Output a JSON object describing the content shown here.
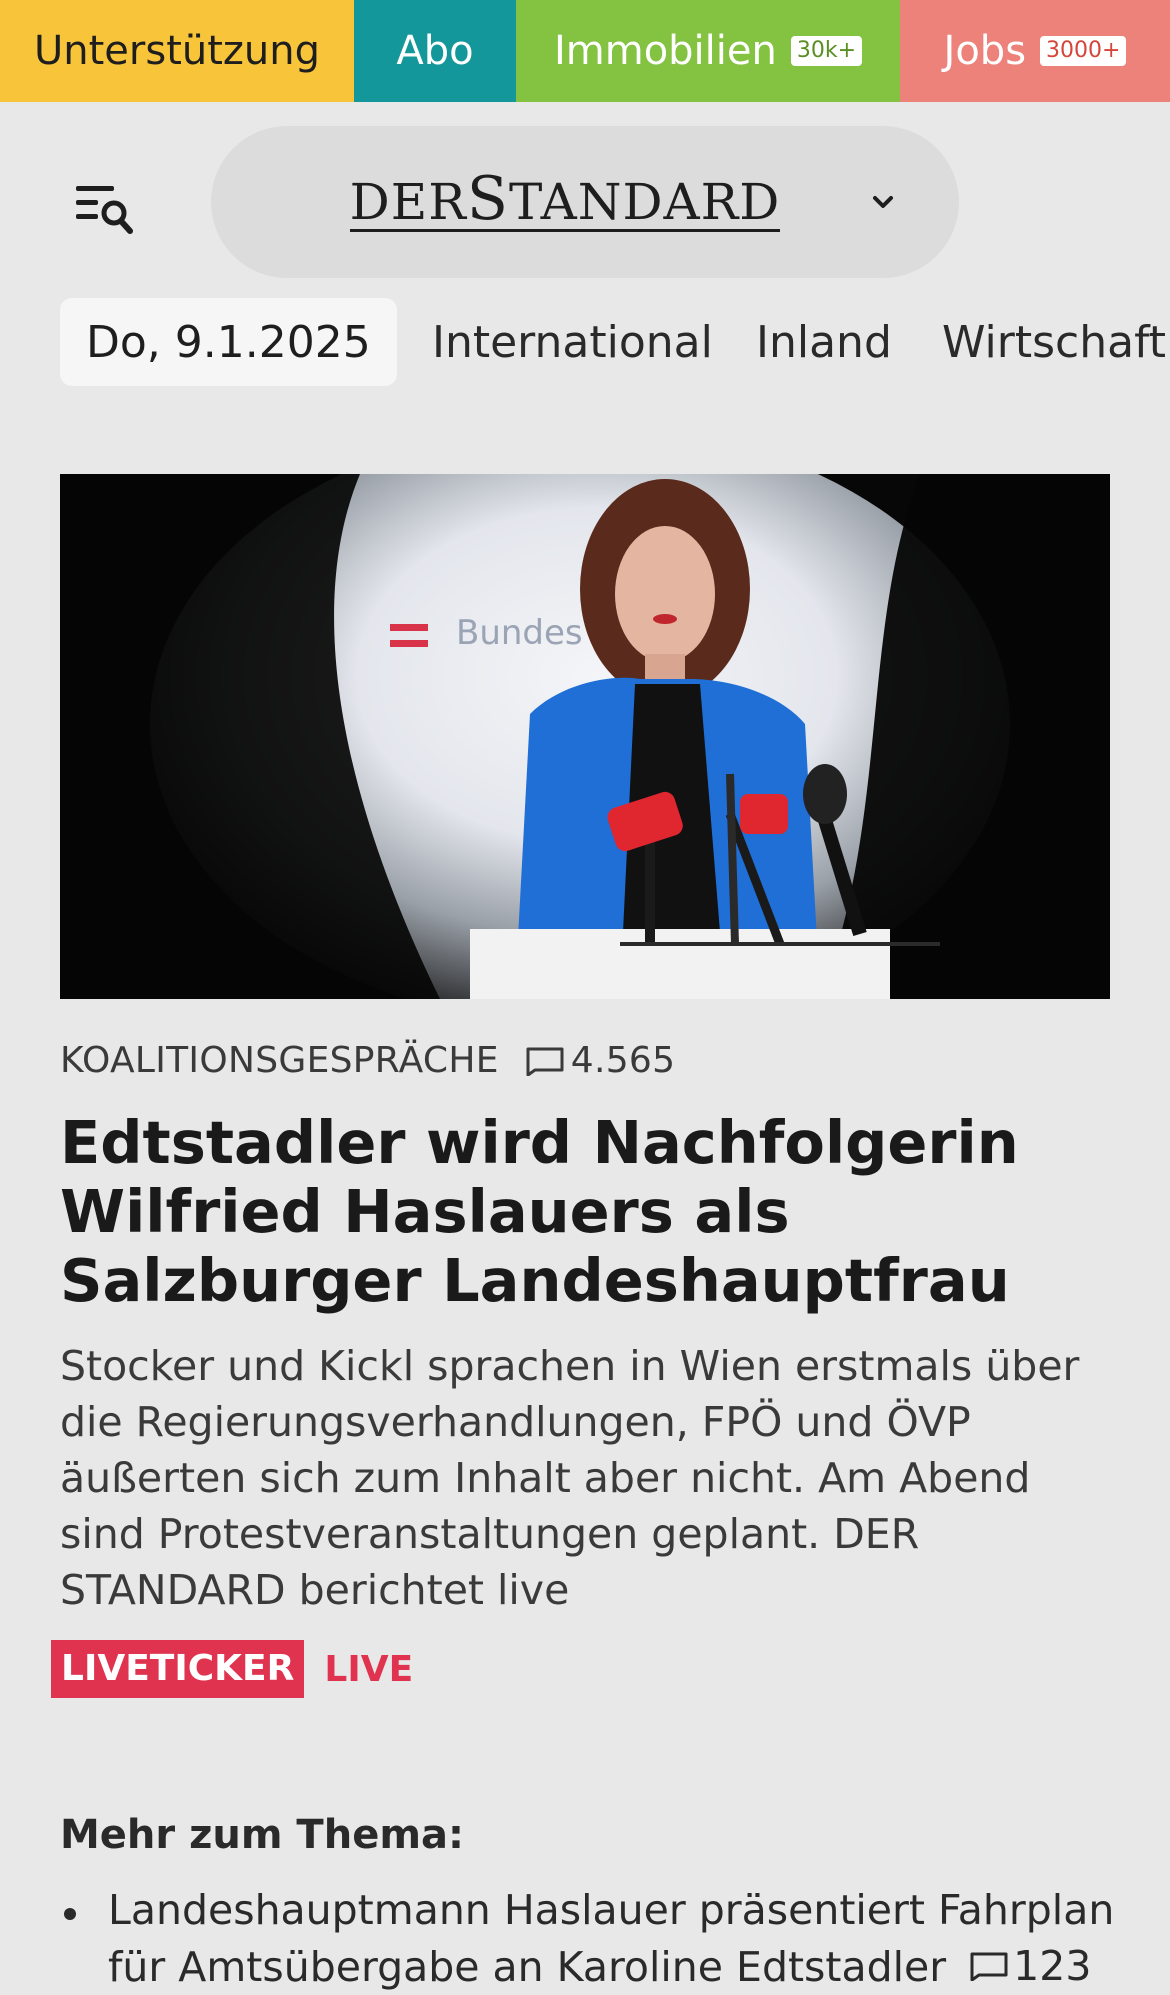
{
  "topbar": {
    "support": "Unterstützung",
    "abo": "Abo",
    "immobilien": "Immobilien",
    "immobilien_badge": "30k+",
    "jobs": "Jobs",
    "jobs_badge": "3000+"
  },
  "header": {
    "logo_prefix": "DER",
    "logo_s": "S",
    "logo_rest": "TANDARD"
  },
  "nav": {
    "date": "Do, 9.1.2025",
    "items": [
      "International",
      "Inland",
      "Wirtschaft"
    ]
  },
  "article": {
    "kicker": "KOALITIONSGESPRÄCHE",
    "comments": "4.565",
    "headline": "Edtstadler wird Nachfolgerin Wilfried Haslauers als Salzburger Landeshauptfrau",
    "lead": "Stocker und Kickl sprachen in Wien erstmals über die Regierungsverhandlungen, FPÖ und ÖVP äußerten sich zum Inhalt aber nicht. Am Abend sind Protestveranstaltungen geplant. DER STANDARD berichtet live",
    "tag": "LIVETICKER",
    "live": "LIVE"
  },
  "more": {
    "title": "Mehr zum Thema:",
    "items": [
      {
        "text": "Landeshauptmann Haslauer präsentiert Fahrplan für Amtsübergabe an Karoline Edtstadler",
        "comments": "123"
      }
    ]
  },
  "colors": {
    "support": "#f8c53a",
    "abo": "#14979a",
    "immobilien": "#84c242",
    "jobs": "#ec8279",
    "live": "#e0334f"
  }
}
